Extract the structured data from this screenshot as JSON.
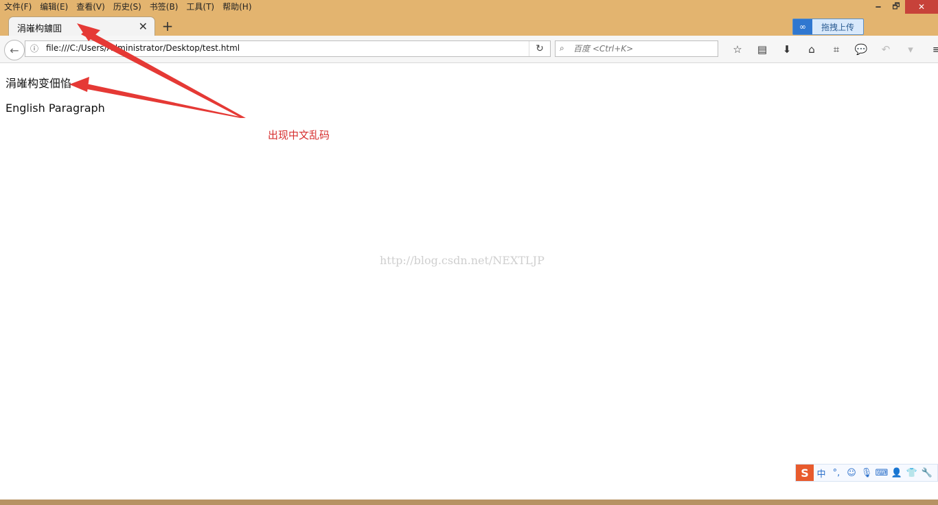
{
  "menu": [
    "文件(F)",
    "编辑(E)",
    "查看(V)",
    "历史(S)",
    "书签(B)",
    "工具(T)",
    "帮助(H)"
  ],
  "window_controls": {
    "minimize": "🗕",
    "restore": "🗗",
    "close": "✕"
  },
  "tab": {
    "title": "涓嶉构鐪囬",
    "close": "✕"
  },
  "new_tab": "+",
  "upload_button": {
    "icon": "∞",
    "label": "拖拽上传"
  },
  "nav": {
    "back": "←",
    "info": "ⓘ",
    "url": "file:///C:/Users/Administrator/Desktop/test.html",
    "reload": "↻",
    "search_placeholder": "百度 <Ctrl+K>",
    "search_icon": "⌕",
    "toolbar": [
      "☆",
      "▤",
      "⬇",
      "⌂",
      "⌗",
      "💬",
      "↶",
      "▾",
      "≡"
    ]
  },
  "page": {
    "heading": "涓嶉构变佃惂",
    "paragraph": "English Paragraph",
    "annotation": "出现中文乱码",
    "watermark": "http://blog.csdn.net/NEXTLJP"
  },
  "ime": [
    "S",
    "中",
    "°,",
    "☺",
    "🎙",
    "⌨",
    "👤",
    "👕",
    "🔧"
  ],
  "colors": {
    "titlebar": "#e3b46f",
    "annotation": "#d62e2e",
    "arrow": "#e53935"
  }
}
